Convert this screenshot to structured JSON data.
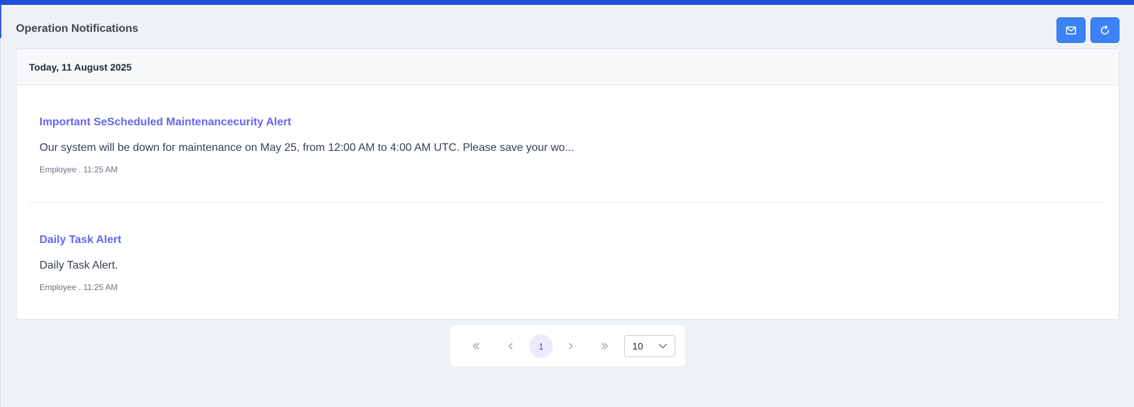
{
  "header": {
    "title": "Operation Notifications",
    "buttons": {
      "mail_icon": "mail-icon",
      "refresh_icon": "refresh-icon"
    }
  },
  "card": {
    "date_heading": "Today, 11 August 2025",
    "notifications": [
      {
        "title": "Important SeScheduled Maintenancecurity Alert",
        "body": "Our system will be down for maintenance on May 25, from 12:00 AM to 4:00 AM UTC. Please save your wo...",
        "meta": "Employee . 11:25 AM"
      },
      {
        "title": "Daily Task Alert",
        "body": "Daily Task Alert.",
        "meta": "Employee . 11:25 AM"
      }
    ]
  },
  "pagination": {
    "current_page": "1",
    "page_size": "10",
    "icons": {
      "first": "double-chevron-left-icon",
      "prev": "chevron-left-icon",
      "next": "chevron-right-icon",
      "last": "double-chevron-right-icon",
      "size_dropdown": "chevron-down-icon"
    }
  },
  "colors": {
    "top_bar": "#1f4fd6",
    "button_bg": "#3b82f6",
    "title_accent": "#6366f1",
    "current_page_bg": "#efeafb",
    "page_bg": "#eef1f6"
  }
}
